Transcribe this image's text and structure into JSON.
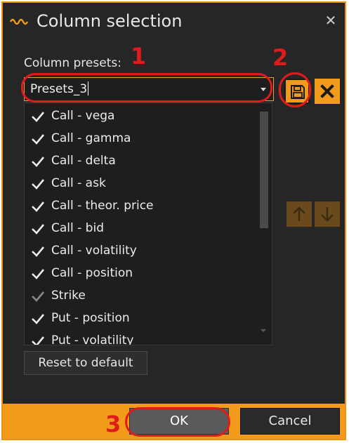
{
  "dialog": {
    "title": "Column selection",
    "title_icon": "wave-icon",
    "close_label": "✕"
  },
  "presets": {
    "label": "Column presets:",
    "selected": "Presets_3"
  },
  "columns": [
    {
      "label": "Call - vega",
      "checked": true
    },
    {
      "label": "Call - gamma",
      "checked": true
    },
    {
      "label": "Call - delta",
      "checked": true
    },
    {
      "label": "Call - ask",
      "checked": true
    },
    {
      "label": "Call - theor. price",
      "checked": true
    },
    {
      "label": "Call - bid",
      "checked": true
    },
    {
      "label": "Call - volatility",
      "checked": true
    },
    {
      "label": "Call - position",
      "checked": true
    },
    {
      "label": "Strike",
      "checked": true,
      "disabled": true
    },
    {
      "label": "Put - position",
      "checked": true
    },
    {
      "label": "Put - volatility",
      "checked": true
    }
  ],
  "buttons": {
    "reset": "Reset to default",
    "ok": "OK",
    "cancel": "Cancel"
  },
  "annotations": [
    "1",
    "2",
    "3"
  ],
  "colors": {
    "accent": "#f29a1a",
    "background": "#262626",
    "annotation": "#e01b1b"
  }
}
